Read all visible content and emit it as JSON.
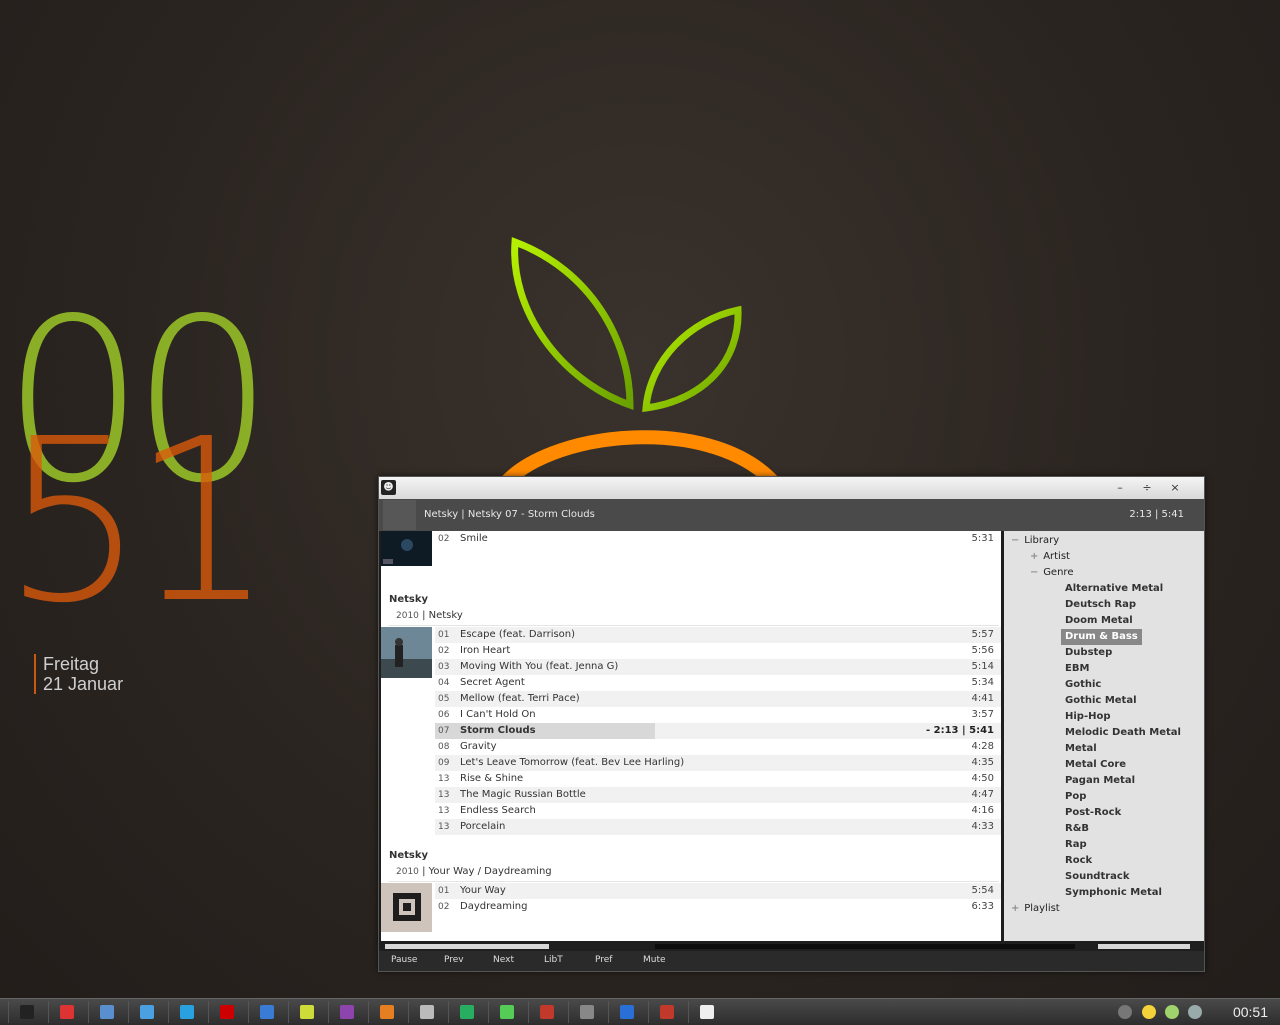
{
  "desktop": {
    "clock_hours": "00",
    "clock_minutes": "51",
    "day": "Freitag",
    "date": "21 Januar"
  },
  "player": {
    "now_playing": "Netsky | Netsky   07 -  Storm Clouds",
    "time": "2:13 | 5:41",
    "window_buttons": {
      "minimize": "–",
      "maximize": "÷",
      "close": "×"
    },
    "prev_album": {
      "tracks": [
        {
          "num": "02",
          "name": "Smile",
          "dur": "5:31"
        }
      ]
    },
    "album1": {
      "artist": "Netsky",
      "year": "2010",
      "title": " | Netsky",
      "tracks": [
        {
          "num": "01",
          "name": "Escape (feat. Darrison)",
          "dur": "5:57"
        },
        {
          "num": "02",
          "name": "Iron Heart",
          "dur": "5:56"
        },
        {
          "num": "03",
          "name": "Moving With You (feat. Jenna G)",
          "dur": "5:14"
        },
        {
          "num": "04",
          "name": "Secret Agent",
          "dur": "5:34"
        },
        {
          "num": "05",
          "name": "Mellow (feat. Terri Pace)",
          "dur": "4:41"
        },
        {
          "num": "06",
          "name": "I Can't Hold On",
          "dur": "3:57"
        },
        {
          "num": "07",
          "name": "Storm Clouds",
          "dur": "- 2:13 | 5:41"
        },
        {
          "num": "08",
          "name": "Gravity",
          "dur": "4:28"
        },
        {
          "num": "09",
          "name": "Let's Leave Tomorrow (feat. Bev Lee Harling)",
          "dur": "4:35"
        },
        {
          "num": "13",
          "name": "Rise & Shine",
          "dur": "4:50"
        },
        {
          "num": "13",
          "name": "The Magic Russian Bottle",
          "dur": "4:47"
        },
        {
          "num": "13",
          "name": "Endless Search",
          "dur": "4:16"
        },
        {
          "num": "13",
          "name": "Porcelain",
          "dur": "4:33"
        }
      ]
    },
    "album2": {
      "artist": "Netsky",
      "year": "2010",
      "title": " | Your Way / Daydreaming",
      "tracks": [
        {
          "num": "01",
          "name": "Your Way",
          "dur": "5:54"
        },
        {
          "num": "02",
          "name": "Daydreaming",
          "dur": "6:33"
        }
      ]
    },
    "tree": {
      "library": "Library",
      "artist": "Artist",
      "genre": "Genre",
      "playlist": "Playlist",
      "genres": [
        "Alternative Metal",
        "Deutsch Rap",
        "Doom Metal",
        "Drum & Bass",
        "Dubstep",
        "EBM",
        "Gothic",
        "Gothic Metal",
        "Hip-Hop",
        "Melodic Death Metal",
        "Metal",
        "Metal Core",
        "Pagan Metal",
        "Pop",
        "Post-Rock",
        "R&B",
        "Rap",
        "Rock",
        "Soundtrack",
        "Symphonic Metal"
      ],
      "selected_genre": "Drum & Bass"
    },
    "progress": 0.39,
    "controls": {
      "pause": "Pause",
      "prev": "Prev",
      "next": "Next",
      "libt": "LibT",
      "pref": "Pref",
      "mute": "Mute"
    }
  },
  "taskbar": {
    "clock": "00:51",
    "apps": [
      "show-desktop",
      "notepad",
      "explorer",
      "messenger",
      "skype",
      "opera",
      "editor",
      "winamp",
      "calendar",
      "archive",
      "player",
      "downloader",
      "terminal",
      "gmail",
      "mail",
      "media",
      "utility",
      "notes"
    ]
  }
}
